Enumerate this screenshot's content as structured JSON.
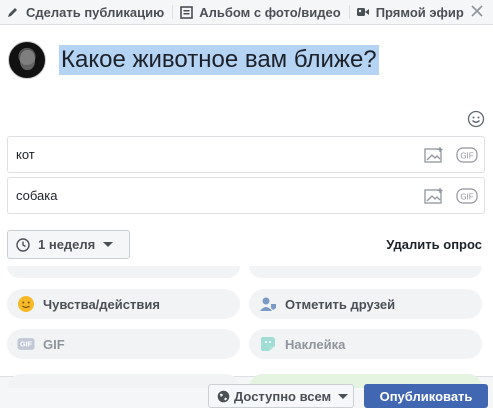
{
  "tabs": [
    {
      "label": "Сделать публикацию",
      "icon": "pencil-icon"
    },
    {
      "label": "Альбом с фото/видео",
      "icon": "album-icon"
    },
    {
      "label": "Прямой эфир",
      "icon": "video-camera-icon"
    }
  ],
  "composer": {
    "question": "Какое животное вам ближе?"
  },
  "poll": {
    "options": [
      {
        "value": "кот"
      },
      {
        "value": "собака"
      }
    ],
    "duration_label": "1 неделя",
    "delete_label": "Удалить опрос"
  },
  "actions": [
    {
      "label": "Чувства/действия",
      "icon": "smiley-icon"
    },
    {
      "label": "Отметить друзей",
      "icon": "tag-friends-icon"
    },
    {
      "label": "GIF",
      "icon": "gif-icon"
    },
    {
      "label": "Наклейка",
      "icon": "sticker-icon"
    }
  ],
  "footer": {
    "audience_label": "Доступно всем",
    "publish_label": "Опубликовать"
  },
  "colors": {
    "primary": "#4267b2",
    "selection": "#b5d3f3",
    "smiley": "#f7b928",
    "tag": "#7b9ac7",
    "sticker": "#7fd3c7"
  }
}
